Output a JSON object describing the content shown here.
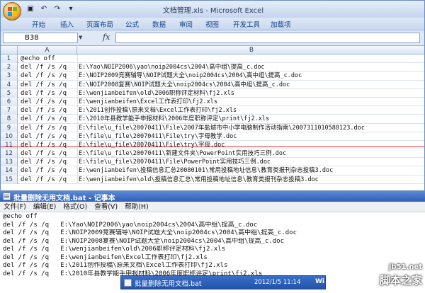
{
  "excel": {
    "window_title": "文档管理.xls - Microsoft Excel",
    "ribbon_tabs": [
      "开始",
      "插入",
      "页面布局",
      "公式",
      "数据",
      "审阅",
      "视图",
      "开发工具",
      "加载项"
    ],
    "name_box": "B38",
    "formula_label": "fx",
    "formula_value": "",
    "column_headers": [
      "A",
      "B"
    ],
    "rows": [
      {
        "num": "1",
        "a": "@echo off",
        "b": ""
      },
      {
        "num": "2",
        "a": "del /f /s /q",
        "b": "E:\\Yao\\NOIP2006\\yao\\noip2004cs\\2004\\高中组\\提高_c.doc"
      },
      {
        "num": "3",
        "a": "del /f /s /q",
        "b": "E:\\NOIP2009竞赛辅导\\NOIP试题大全\\noip2004cs\\2004\\高中组\\提高_c.doc"
      },
      {
        "num": "4",
        "a": "del /f /s /q",
        "b": "E:\\NOIP2008复赛\\NOIP试题大全\\noip2004cs\\2004\\高中组\\提高_c.doc"
      },
      {
        "num": "5",
        "a": "del /f /s /q",
        "b": "E:\\wenjianbeifen\\old\\2006职称评定材料\\fj2.xls"
      },
      {
        "num": "6",
        "a": "del /f /s /q",
        "b": "E:\\wenjianbeifen\\Excel工作表打印\\fj2.xls"
      },
      {
        "num": "7",
        "a": "del /f /s /q",
        "b": "E:\\2011创作投稿\\原来文档\\Excel工作表打印\\fj2.xls"
      },
      {
        "num": "8",
        "a": "del /f /s /q",
        "b": "E:\\2010年县教学能手申报材料\\2006年度职称评定\\print\\fj2.xls"
      },
      {
        "num": "9",
        "a": "del /f /s /q",
        "b": "E:\\file\\u_file\\20070411\\File\\2007年盐城市中小学电脑制作活动指南\\2007311010588123.doc"
      },
      {
        "num": "10",
        "a": "del /f /s /q",
        "b": "E:\\file\\u_file\\20070411\\File\\try\\字母教学.doc"
      },
      {
        "num": "11",
        "a": "del /f /s /q",
        "b": "E:\\file\\u_file\\20070411\\File\\try\\字母.doc"
      },
      {
        "num": "12",
        "a": "del /f /s /q",
        "b": "E:\\file\\u_file\\20070411\\新建文件夹\\PowerPoint实用技巧三例.doc"
      },
      {
        "num": "13",
        "a": "del /f /s /q",
        "b": "E:\\file\\u_file\\20070411\\File\\PowerPoint实用技巧三例.doc"
      },
      {
        "num": "14",
        "a": "del /f /s /q",
        "b": "E:\\wenjianbeifen\\投稿信息汇总20080101\\常用投稿地址信息\\教育类报刊杂志投稿3.doc"
      },
      {
        "num": "15",
        "a": "del /f /s /q",
        "b": "E:\\wenjianbeifen\\old\\投稿信息汇总\\常用投稿地址信息\\教育类报刊杂志投稿3.doc"
      }
    ]
  },
  "notepad": {
    "title": "批量删除无用文档.bat - 记事本",
    "menu": [
      "文件(F)",
      "编辑(E)",
      "格式(O)",
      "查看(V)",
      "帮助(H)"
    ],
    "lines": [
      "@echo off",
      "del /f /s /q   E:\\Yao\\NOIP2006\\yao\\noip2004cs\\2004\\高中组\\提高_c.doc",
      "del /f /s /q   E:\\NOIP2009竞赛辅导\\NOIP试题大全\\noip2004cs\\2004\\高中组\\提高_c.doc",
      "del /f /s /q   E:\\NOIP2008复赛\\NOIP试题大全\\noip2004cs\\2004\\高中组\\提高_c.doc",
      "del /f /s /q   E:\\wenjianbeifen\\old\\2006职称评定材料\\fj2.xls",
      "del /f /s /q   E:\\wenjianbeifen\\Excel工作表打印\\fj2.xls",
      "del /f /s /q   E:\\2011创作投稿\\原来文档\\Excel工作表打印\\fj2.xls",
      "del /f /s /q   E:\\2010年县教学能手申报材料\\2006年度职称评定\\print\\fj2.xls"
    ]
  },
  "taskbar": {
    "task_label": "批量删除无用文档.bat",
    "datetime": "2012/1/5 11:14",
    "extra": "Wi"
  },
  "watermark": {
    "line1": "jb51.net",
    "line2": "脚本之家"
  },
  "colors": {
    "excel_frame": "#c9d9ee",
    "ribbon_text": "#15428b",
    "notepad_title": "#2f5fb8",
    "marker_line": "#e03030"
  }
}
